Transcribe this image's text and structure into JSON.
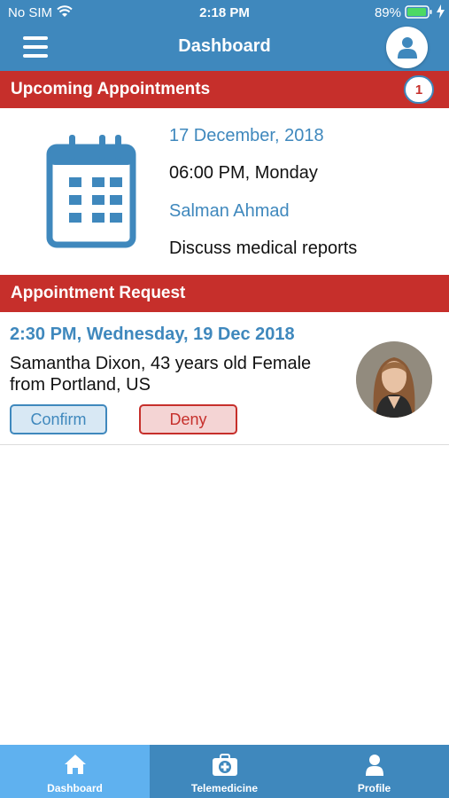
{
  "status_bar": {
    "carrier": "No SIM",
    "time": "2:18 PM",
    "battery": "89%"
  },
  "header": {
    "title": "Dashboard",
    "menu_icon": "hamburger-icon",
    "profile_icon": "user-icon"
  },
  "upcoming": {
    "title": "Upcoming Appointments",
    "count": "1",
    "appointment": {
      "date": "17 December, 2018",
      "time": "06:00 PM, Monday",
      "name": "Salman Ahmad",
      "note": "Discuss medical reports",
      "icon": "calendar-icon"
    }
  },
  "requests": {
    "title": "Appointment Request",
    "item": {
      "time": "2:30 PM, Wednesday, 19 Dec 2018",
      "description": "Samantha Dixon, 43 years old Female from Portland, US",
      "confirm_label": "Confirm",
      "deny_label": "Deny"
    }
  },
  "tabbar": {
    "items": [
      {
        "label": "Dashboard",
        "icon": "home-icon",
        "active": true
      },
      {
        "label": "Telemedicine",
        "icon": "medical-kit-icon",
        "active": false
      },
      {
        "label": "Profile",
        "icon": "user-icon",
        "active": false
      }
    ]
  },
  "colors": {
    "primary": "#3f88bd",
    "accent": "#c62f2b",
    "tab_active": "#5fb1ef"
  }
}
